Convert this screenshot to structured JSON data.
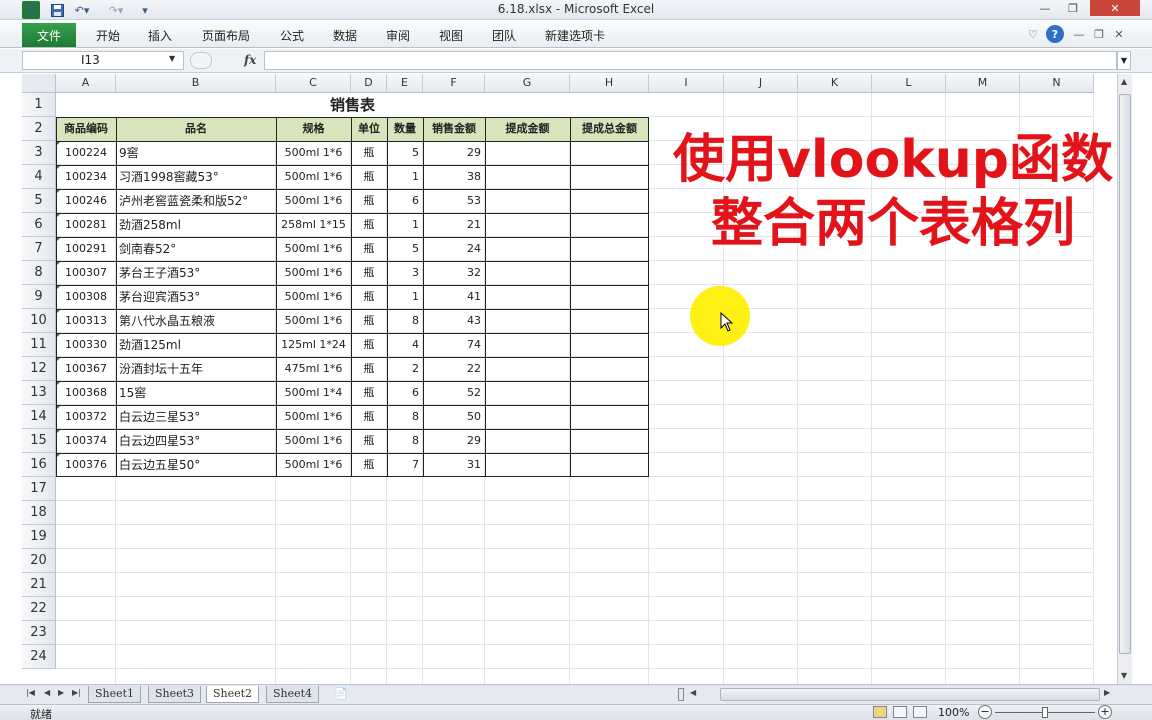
{
  "window": {
    "title": "6.18.xlsx  -  Microsoft Excel",
    "app_icon": "X",
    "quick_access": [
      "save-icon",
      "undo-icon",
      "redo-icon",
      "customize-icon"
    ]
  },
  "ribbon": {
    "file_tab": "文件",
    "tabs": [
      "开始",
      "插入",
      "页面布局",
      "公式",
      "数据",
      "审阅",
      "视图",
      "团队",
      "新建选项卡"
    ]
  },
  "formula_bar": {
    "name_box": "I13",
    "fx_label": "fx",
    "formula": ""
  },
  "columns": [
    "A",
    "B",
    "C",
    "D",
    "E",
    "F",
    "G",
    "H",
    "I",
    "J",
    "K",
    "L",
    "M",
    "N"
  ],
  "rows": [
    "1",
    "2",
    "3",
    "4",
    "5",
    "6",
    "7",
    "8",
    "9",
    "10",
    "11",
    "12",
    "13",
    "14",
    "15",
    "16",
    "17",
    "18",
    "19",
    "20",
    "21",
    "22",
    "23",
    "24"
  ],
  "sheet": {
    "title": "销售表",
    "headers": [
      "商品编码",
      "品名",
      "规格",
      "单位",
      "数量",
      "销售金额",
      "提成金额",
      "提成总金额"
    ],
    "data": [
      [
        "100224",
        "9窖",
        "500ml 1*6",
        "瓶",
        "5",
        "29"
      ],
      [
        "100234",
        "习酒1998窖藏53°",
        "500ml 1*6",
        "瓶",
        "1",
        "38"
      ],
      [
        "100246",
        "泸州老窖蓝瓷柔和版52°",
        "500ml 1*6",
        "瓶",
        "6",
        "53"
      ],
      [
        "100281",
        "劲酒258ml",
        "258ml 1*15",
        "瓶",
        "1",
        "21"
      ],
      [
        "100291",
        "剑南春52°",
        "500ml 1*6",
        "瓶",
        "5",
        "24"
      ],
      [
        "100307",
        "茅台王子酒53°",
        "500ml 1*6",
        "瓶",
        "3",
        "32"
      ],
      [
        "100308",
        "茅台迎宾酒53°",
        "500ml 1*6",
        "瓶",
        "1",
        "41"
      ],
      [
        "100313",
        "第八代水晶五粮液",
        "500ml 1*6",
        "瓶",
        "8",
        "43"
      ],
      [
        "100330",
        "劲酒125ml",
        "125ml 1*24",
        "瓶",
        "4",
        "74"
      ],
      [
        "100367",
        "汾酒封坛十五年",
        "475ml 1*6",
        "瓶",
        "2",
        "22"
      ],
      [
        "100368",
        "15窖",
        "500ml 1*4",
        "瓶",
        "6",
        "52"
      ],
      [
        "100372",
        "白云边三星53°",
        "500ml 1*6",
        "瓶",
        "8",
        "50"
      ],
      [
        "100374",
        "白云边四星53°",
        "500ml 1*6",
        "瓶",
        "8",
        "29"
      ],
      [
        "100376",
        "白云边五星50°",
        "500ml 1*6",
        "瓶",
        "7",
        "31"
      ]
    ]
  },
  "overlay": {
    "line1": "使用vlookup函数",
    "line2": "整合两个表格列",
    "color": "#e3131a"
  },
  "sheet_tabs": [
    "Sheet1",
    "Sheet3",
    "Sheet2",
    "Sheet4"
  ],
  "active_sheet": "Sheet2",
  "status": {
    "ready": "就绪",
    "zoom": "100%"
  }
}
